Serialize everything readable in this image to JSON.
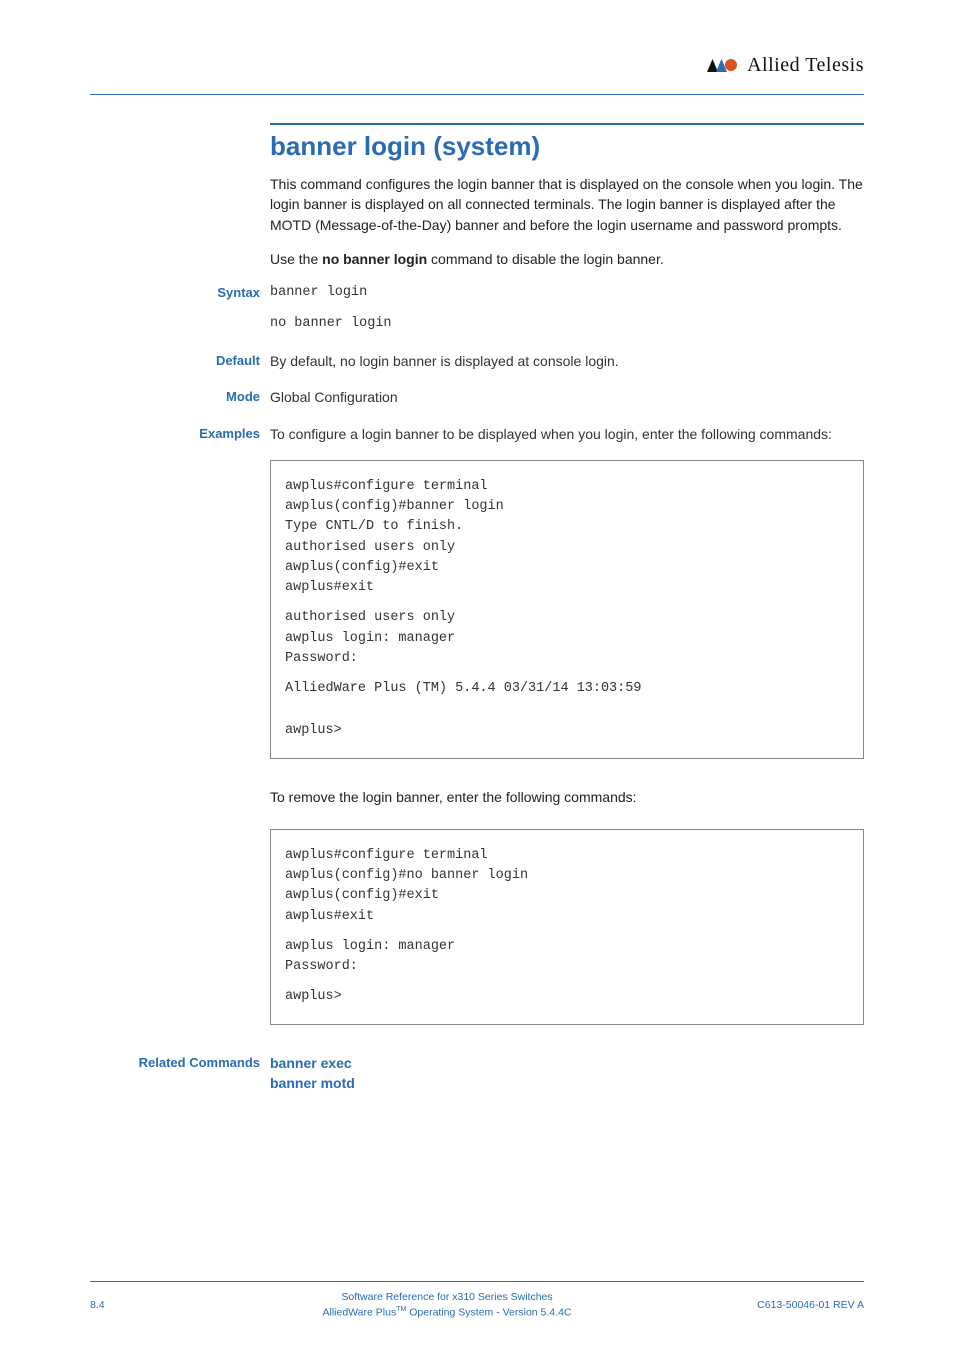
{
  "header": {
    "brand": "Allied Telesis"
  },
  "title": "banner login (system)",
  "description": "This command configures the login banner that is displayed on the console when you login. The login banner is displayed on all connected terminals. The login banner is displayed after the MOTD (Message-of-the-Day) banner and before the login username and password prompts.",
  "usage_prefix": "Use the ",
  "usage_bold": "no banner login",
  "usage_suffix": " command to disable the login banner.",
  "labels": {
    "syntax": "Syntax",
    "default": "Default",
    "mode": "Mode",
    "examples": "Examples",
    "related": "Related Commands"
  },
  "syntax": {
    "line1": "banner login",
    "line2": "no banner login"
  },
  "default_text": "By default, no login banner is displayed at console login.",
  "mode_text": "Global Configuration",
  "examples_intro": "To configure a login banner to be displayed when you login, enter the following commands:",
  "example1": {
    "l1": "awplus#configure terminal",
    "l2": "awplus(config)#banner login",
    "l3": "Type CNTL/D to finish.",
    "l4": "authorised users only",
    "l5": "awplus(config)#exit",
    "l6": "awplus#exit",
    "l7": "authorised users only",
    "l8": "awplus login: manager",
    "l9": "Password:",
    "l10": "AlliedWare Plus (TM) 5.4.4 03/31/14 13:03:59",
    "l11": "awplus>"
  },
  "examples_intro2": "To remove the login banner, enter the following commands:",
  "example2": {
    "l1": "awplus#configure terminal",
    "l2": "awplus(config)#no banner login",
    "l3": "awplus(config)#exit",
    "l4": "awplus#exit",
    "l5": "awplus login: manager",
    "l6": "Password:",
    "l7": "awplus>"
  },
  "related": {
    "link1": "banner exec",
    "link2": "banner motd"
  },
  "footer": {
    "page": "8.4",
    "center1": "Software Reference for x310 Series Switches",
    "center2_a": "AlliedWare Plus",
    "center2_b": "TM",
    "center2_c": " Operating System  - Version 5.4.4C",
    "right": "C613-50046-01 REV A"
  }
}
